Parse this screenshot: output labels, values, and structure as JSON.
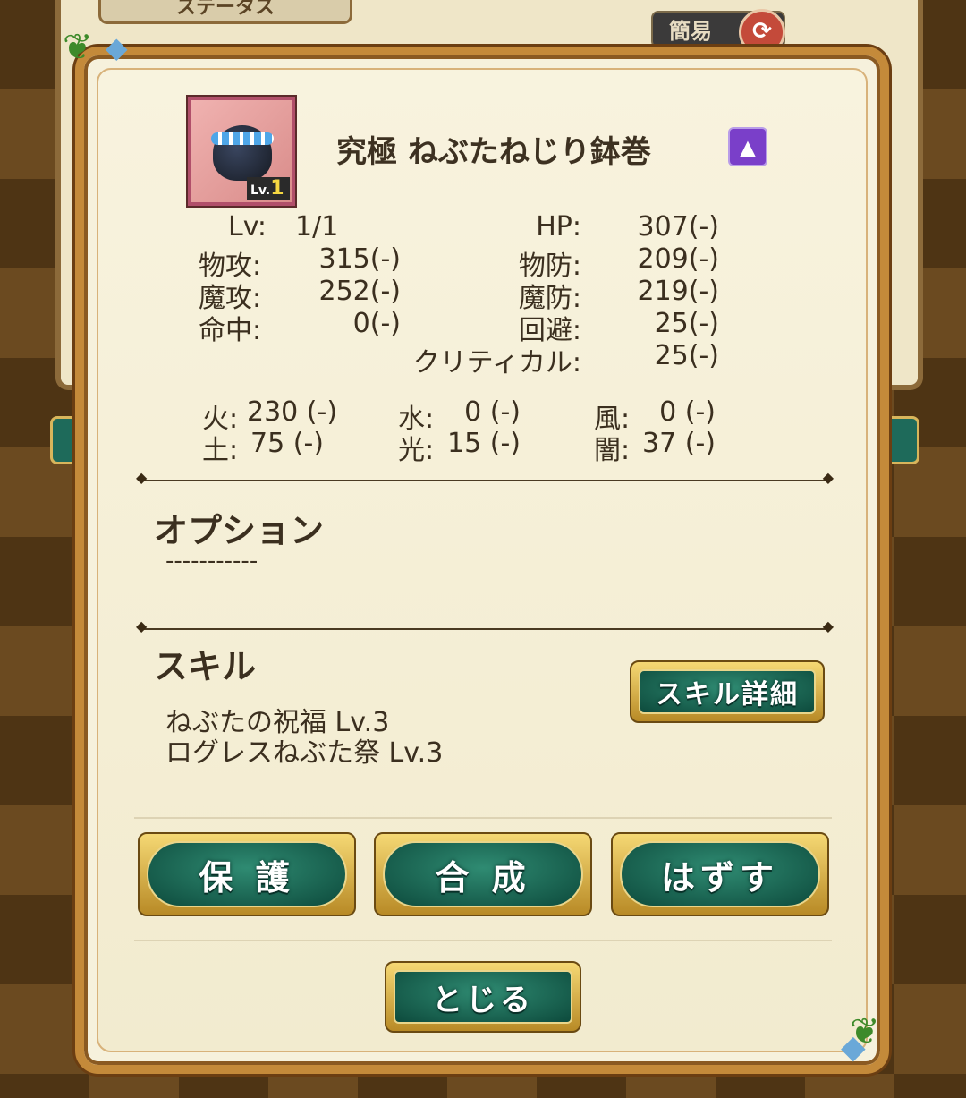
{
  "background": {
    "tab_label": "ステータス",
    "simple_label": "簡易"
  },
  "item": {
    "name": "究極 ねぶたねじり鉢巻",
    "icon_level_prefix": "Lv.",
    "icon_level": "1"
  },
  "stats": {
    "lv_label": "Lv:",
    "lv_value": "1/1",
    "hp_label": "HP:",
    "hp_value": "307(-)",
    "patk_label": "物攻:",
    "patk_value": "315(-)",
    "pdef_label": "物防:",
    "pdef_value": "209(-)",
    "matk_label": "魔攻:",
    "matk_value": "252(-)",
    "mdef_label": "魔防:",
    "mdef_value": "219(-)",
    "acc_label": "命中:",
    "acc_value": "0(-)",
    "eva_label": "回避:",
    "eva_value": "25(-)",
    "crit_label": "クリティカル:",
    "crit_value": "25(-)"
  },
  "elements": {
    "fire_label": "火:",
    "fire_value": "230 (-)",
    "water_label": "水:",
    "water_value": "0 (-)",
    "wind_label": "風:",
    "wind_value": "0 (-)",
    "earth_label": "土:",
    "earth_value": "75 (-)",
    "light_label": "光:",
    "light_value": "15 (-)",
    "dark_label": "闇:",
    "dark_value": "37 (-)"
  },
  "option": {
    "heading": "オプション",
    "value": "-----------"
  },
  "skill": {
    "heading": "スキル",
    "detail_button": "スキル詳細",
    "items": [
      "ねぶたの祝福  Lv.3",
      "ログレスねぶた祭  Lv.3"
    ]
  },
  "buttons": {
    "protect": "保 護",
    "synthesize": "合 成",
    "remove": "はずす",
    "close": "とじる"
  }
}
